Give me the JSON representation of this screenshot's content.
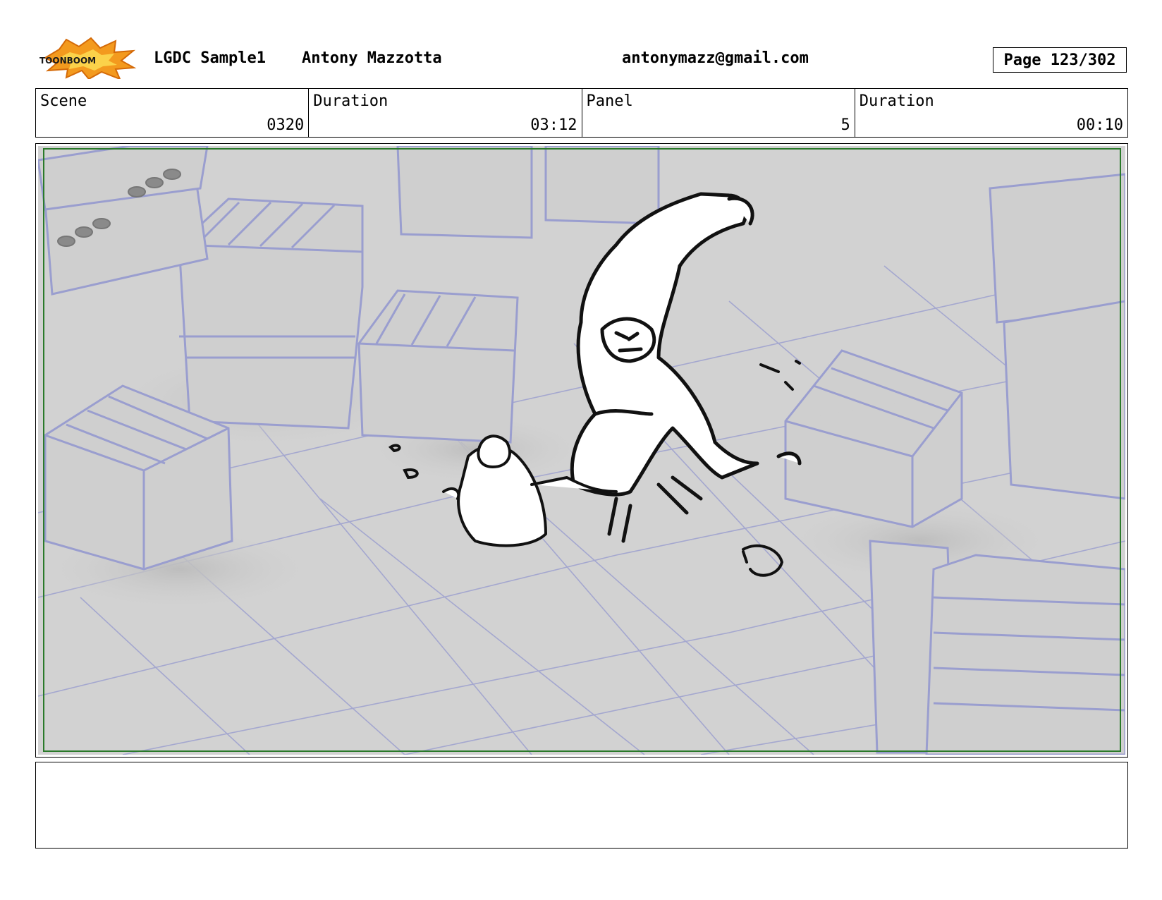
{
  "header": {
    "logo_text": "TOONBOOM",
    "project": "LGDC Sample1",
    "author": "Antony Mazzotta",
    "email": "antonymazz@gmail.com",
    "page": "Page 123/302"
  },
  "info": {
    "scene_label": "Scene",
    "scene_value": "0320",
    "duration_label": "Duration",
    "duration_value": "03:12",
    "panel_label": "Panel",
    "panel_value": "5",
    "panel_duration_label": "Duration",
    "panel_duration_value": "00:10"
  },
  "colors": {
    "background_line": "#9fa3cc",
    "floor": "#d2d2d2",
    "safe_frame": "#2a7a2a",
    "logo_orange": "#f08a1c"
  },
  "notes": ""
}
